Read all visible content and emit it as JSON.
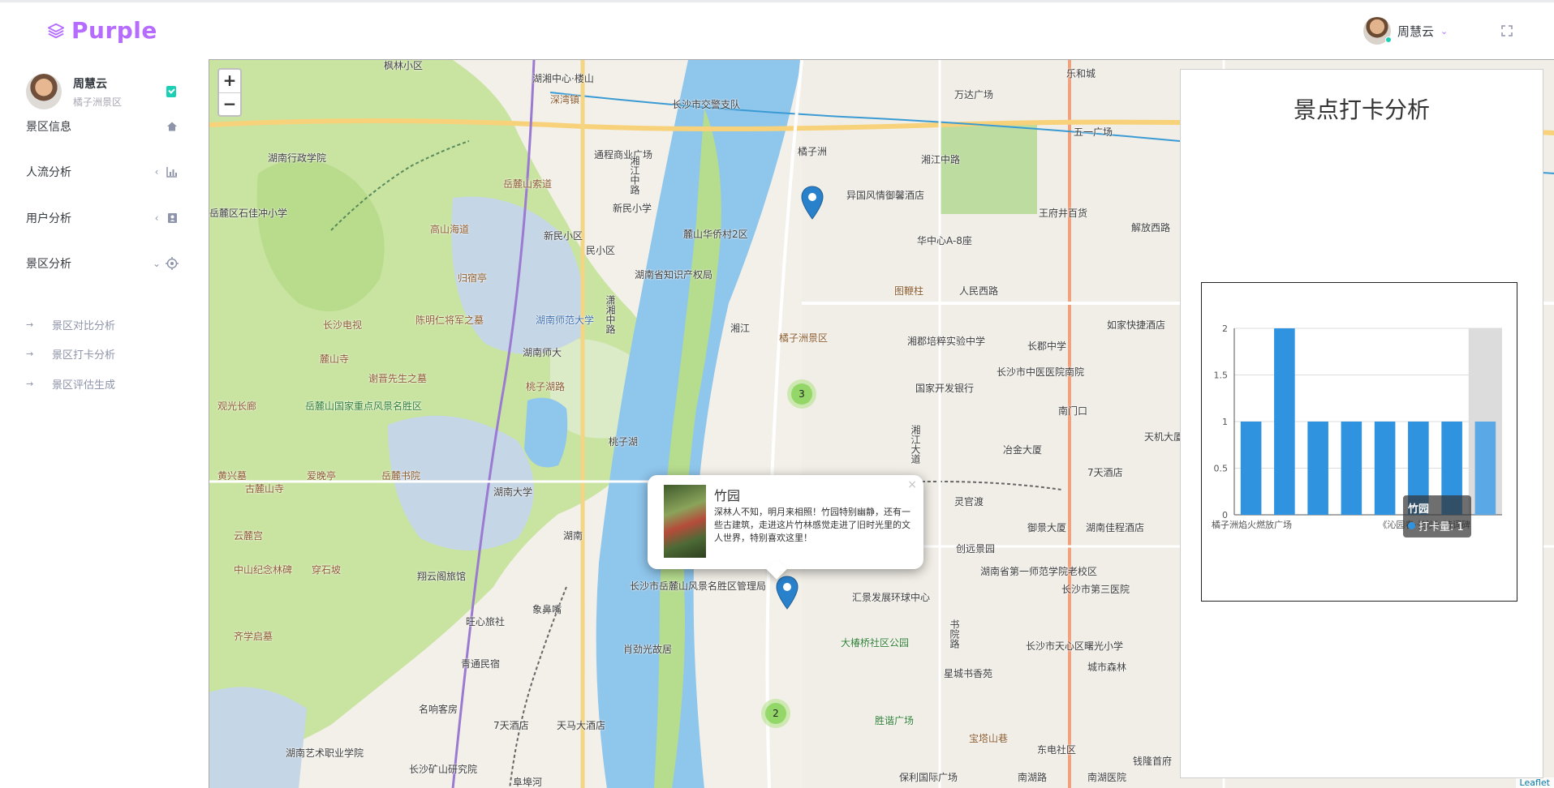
{
  "app": {
    "brand": "Purple"
  },
  "navbar": {
    "user_name": "周慧云"
  },
  "sidebar": {
    "profile": {
      "name": "周慧云",
      "subtitle": "橘子洲景区"
    },
    "menu": [
      {
        "label": "景区信息",
        "icon": "home-icon"
      },
      {
        "label": "人流分析",
        "icon": "bar-chart-icon"
      },
      {
        "label": "用户分析",
        "icon": "contacts-icon"
      },
      {
        "label": "景区分析",
        "icon": "crosshairs-icon"
      }
    ],
    "submenu": [
      {
        "label": "景区对比分析"
      },
      {
        "label": "景区打卡分析"
      },
      {
        "label": "景区评估生成"
      }
    ]
  },
  "map": {
    "zoom_in": "+",
    "zoom_out": "−",
    "clusters": [
      "3",
      "2"
    ],
    "popup": {
      "title": "竹园",
      "description": "深林人不知，明月来相照！竹园特别幽静，还有一些古建筑，走进这片竹林感觉走进了旧时光里的文人世界，特别喜欢这里！",
      "close": "×"
    },
    "attribution": "Leaflet",
    "labels": [
      "枫林小区",
      "湖湘中心·楼山",
      "深湾镇",
      "长沙市交警支队",
      "乐和城",
      "万达广场",
      "五一广场",
      "湖南行政学院",
      "通程商业广场",
      "橘子洲",
      "湘江中路",
      "岳麓山索道",
      "新民小学",
      "高山海道",
      "新民小区",
      "民小区",
      "麓山华侨村2区",
      "异国风情御馨酒店",
      "华中心A-8座",
      "王府井百货",
      "解放西路",
      "湖南省知识产权局",
      "岳麓区石佳冲小学",
      "归宿亭",
      "湖南师范大学",
      "长沙电视",
      "陈明仁将军之墓",
      "湖南师大",
      "橘子洲景区",
      "图鞭柱",
      "人民西路",
      "湘郡培粹实验中学",
      "长郡中学",
      "如家快捷酒店",
      "麓山寺",
      "谢晋先生之墓",
      "桃子湖路",
      "国家开发银行",
      "长沙市中医医院南院",
      "南门口",
      "观光长廊",
      "岳麓山国家重点风景名胜区",
      "桃子湖",
      "冶金大厦",
      "天机大厦",
      "黄兴墓",
      "爱晚亭",
      "岳麓书院",
      "湖南大学",
      "灵官渡",
      "7天酒店",
      "古麓山寺",
      "湖南",
      "御景大厦",
      "湖南佳程酒店",
      "云麓宫",
      "中山纪念林碑",
      "穿石坡",
      "创远景园",
      "湖南省第一师范学院老校区",
      "长沙市第三医院",
      "翔云阁旅馆",
      "长沙市岳麓山风景名胜区管理局",
      "汇景发展环球中心",
      "旺心旅社",
      "象鼻嘴",
      "齐学启墓",
      "肖劲光故居",
      "大椿桥社区公园",
      "长沙市天心区曙光小学",
      "星城书香苑",
      "城市森林",
      "青通民宿",
      "名响客房",
      "7天酒店",
      "天马大酒店",
      "胜谐广场",
      "宝塔山巷",
      "东电社区",
      "钱隆首府",
      "湖南艺术职业学院",
      "长沙矿山研究院",
      "阜埠河",
      "保利国际广场",
      "南湖路",
      "南湖医院",
      "湘江",
      "湘江中路",
      "潇湘中路",
      "湘江大道",
      "书院路"
    ]
  },
  "panel": {
    "title": "景点打卡分析",
    "tooltip": {
      "title": "竹园",
      "series_label": "打卡量",
      "value": "1",
      "row_text": "打卡量: 1"
    }
  },
  "chart_data": {
    "type": "bar",
    "title": "",
    "series": [
      {
        "name": "打卡量",
        "values": [
          1,
          2,
          1,
          1,
          1,
          1,
          1,
          1
        ]
      }
    ],
    "visible_category_labels": [
      "橘子洲焰火燃放广场",
      "《沁园春·长沙》诗词碑"
    ],
    "highlighted_index": 7,
    "ylim": [
      0,
      2
    ],
    "yticks": [
      0,
      0.5,
      1,
      1.5,
      2
    ],
    "grid": true,
    "bar_color": "#2f93e0",
    "highlight_color": "#5aa8e6",
    "highlight_band_color": "#dcdcdc"
  }
}
